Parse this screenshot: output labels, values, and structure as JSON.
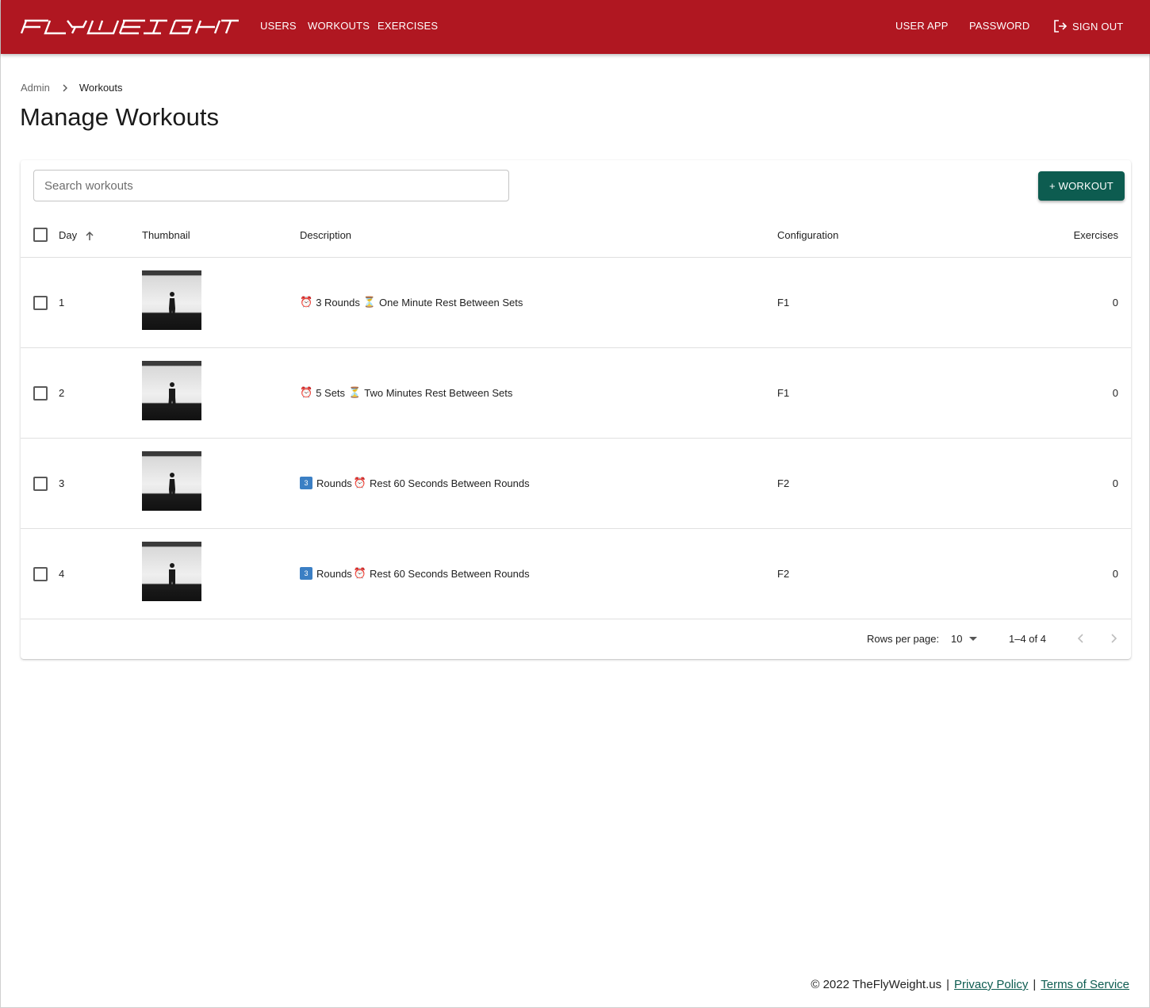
{
  "topbar": {
    "brand": "FLYWEIGHT",
    "nav_left": [
      "USERS",
      "WORKOUTS",
      "EXERCISES"
    ],
    "nav_right": [
      "USER APP",
      "PASSWORD",
      "SIGN OUT"
    ],
    "brand_color": "#b01721"
  },
  "breadcrumb": {
    "root": "Admin",
    "current": "Workouts"
  },
  "page": {
    "title": "Manage Workouts"
  },
  "toolbar": {
    "search_placeholder": "Search workouts",
    "add_label": "+ WORKOUT",
    "accent_color": "#0d5c50"
  },
  "table": {
    "columns": [
      "Day",
      "Thumbnail",
      "Description",
      "Configuration",
      "Exercises"
    ],
    "sort_icon": "arrow-up-icon",
    "rows": [
      {
        "day": "1",
        "desc_icon_a": "⏰",
        "desc_a": "3 Rounds",
        "desc_icon_b": "⏳",
        "desc_b": "One Minute Rest Between Sets",
        "config": "F1",
        "exercises": "0"
      },
      {
        "day": "2",
        "desc_icon_a": "⏰",
        "desc_a": "5 Sets",
        "desc_icon_b": "⏳",
        "desc_b": "Two Minutes Rest Between Sets",
        "config": "F1",
        "exercises": "0"
      },
      {
        "day": "3",
        "desc_icon_a": "3",
        "desc_a": "Rounds",
        "desc_icon_b": "⏰",
        "desc_b": "Rest 60 Seconds Between Rounds",
        "config": "F2",
        "exercises": "0"
      },
      {
        "day": "4",
        "desc_icon_a": "3",
        "desc_a": "Rounds",
        "desc_icon_b": "⏰",
        "desc_b": "Rest 60 Seconds Between Rounds",
        "config": "F2",
        "exercises": "0"
      }
    ]
  },
  "pagination": {
    "rows_per_page_label": "Rows per page:",
    "rows_per_page": "10",
    "range": "1–4 of 4"
  },
  "footer": {
    "copyright": "© 2022 TheFlyWeight.us",
    "privacy": "Privacy Policy",
    "terms": "Terms of Service",
    "separator": "|"
  }
}
